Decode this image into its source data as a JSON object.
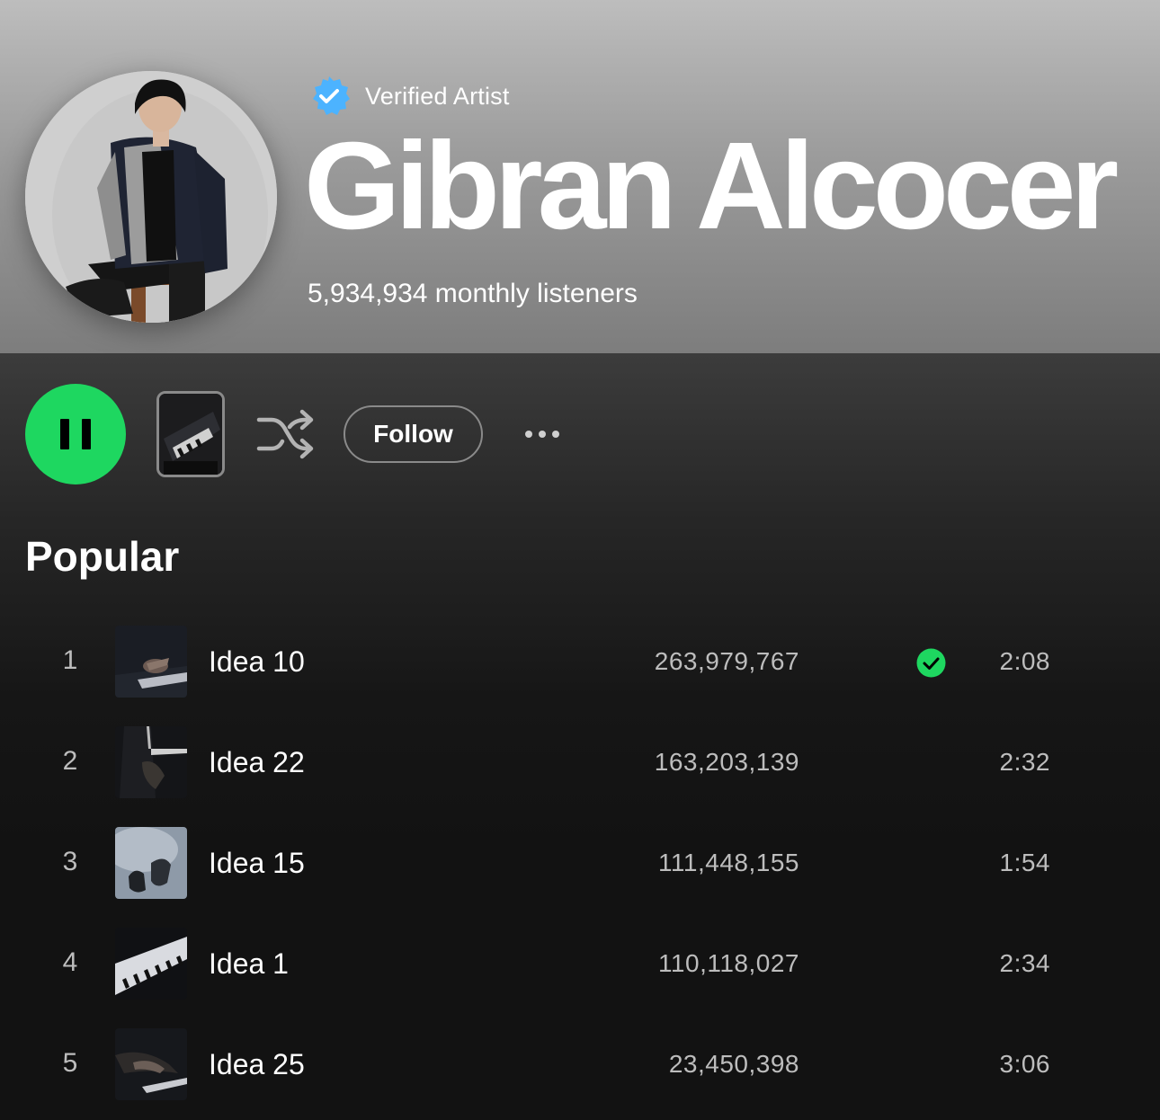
{
  "artist": {
    "verified_label": "Verified Artist",
    "name": "Gibran Alcocer",
    "monthly_listeners": "5,934,934 monthly listeners"
  },
  "colors": {
    "accent_green": "#1ed760",
    "verified_blue": "#4cb3ff",
    "background": "#121212"
  },
  "controls": {
    "follow_label": "Follow"
  },
  "popular": {
    "title": "Popular",
    "tracks": [
      {
        "rank": "1",
        "title": "Idea 10",
        "plays": "263,979,767",
        "duration": "2:08",
        "saved": true
      },
      {
        "rank": "2",
        "title": "Idea 22",
        "plays": "163,203,139",
        "duration": "2:32",
        "saved": false
      },
      {
        "rank": "3",
        "title": "Idea 15",
        "plays": "111,448,155",
        "duration": "1:54",
        "saved": false
      },
      {
        "rank": "4",
        "title": "Idea 1",
        "plays": "110,118,027",
        "duration": "2:34",
        "saved": false
      },
      {
        "rank": "5",
        "title": "Idea 25",
        "plays": "23,450,398",
        "duration": "3:06",
        "saved": false
      }
    ]
  }
}
